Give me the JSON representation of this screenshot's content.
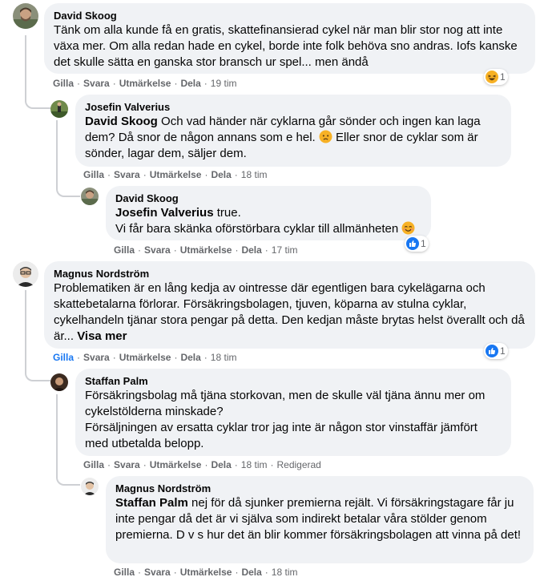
{
  "comments": [
    {
      "author": "David Skoog",
      "text": "Tänk om alla kunde få en gratis, skattefinansierad cykel när man blir stor nog att inte växa mer. Om alla redan hade en cykel, borde inte folk behöva sno andras. Iofs kanske det skulle sätta en ganska stor bransch ur spel... men ändå",
      "actions": {
        "like": "Gilla",
        "reply": "Svara",
        "award": "Utmärkelse",
        "share": "Dela",
        "time": "19 tim"
      },
      "reaction": {
        "icon": "haha-icon",
        "count": "1"
      }
    },
    {
      "author": "Josefin Valverius",
      "mention": "David Skoog",
      "text": " Och vad händer när cyklarna går sönder och ingen kan laga dem? Då snor de någon annans som e hel. ",
      "text_after": " Eller snor de cyklar som är sönder, lagar dem, säljer dem.",
      "actions": {
        "like": "Gilla",
        "reply": "Svara",
        "award": "Utmärkelse",
        "share": "Dela",
        "time": "18 tim"
      }
    },
    {
      "author": "David Skoog",
      "mention": "Josefin Valverius",
      "text": " true.",
      "text_line2": "Vi får bara skänka oförstörbara cyklar till allmänheten ",
      "actions": {
        "like": "Gilla",
        "reply": "Svara",
        "award": "Utmärkelse",
        "share": "Dela",
        "time": "17 tim"
      },
      "reaction": {
        "icon": "like-icon",
        "count": "1"
      }
    },
    {
      "author": "Magnus Nordström",
      "text": "Problematiken är en lång kedja av ointresse där egentligen bara cykelägarna och skattebetalarna förlorar. Försäkringsbolagen, tjuven, köparna av stulna cyklar, cykelhandeln tjänar stora pengar på detta. Den kedjan måste brytas helst överallt och då är... ",
      "see_more": "Visa mer",
      "actions": {
        "like": "Gilla",
        "reply": "Svara",
        "award": "Utmärkelse",
        "share": "Dela",
        "time": "18 tim"
      },
      "reaction": {
        "icon": "like-icon",
        "count": "1"
      }
    },
    {
      "author": "Staffan Palm",
      "text": "Försäkringsbolag må tjäna storkovan, men de skulle väl tjäna ännu mer om cykelstölderna minskade?\nFörsäljningen av ersatta cyklar tror jag inte är någon stor vinstaffär jämfört med utbetalda belopp.",
      "actions": {
        "like": "Gilla",
        "reply": "Svara",
        "award": "Utmärkelse",
        "share": "Dela",
        "time": "18 tim",
        "edited": "Redigerad"
      }
    },
    {
      "author": "Magnus Nordström",
      "mention": "Staffan Palm",
      "text": " nej för då sjunker premierna rejält. Vi försäkringstagare får ju inte pengar då det är vi själva som indirekt betalar våra stölder genom premierna. D v s hur det än blir kommer försäkringsbolagen att vinna på det!",
      "actions": {
        "like": "Gilla",
        "reply": "Svara",
        "award": "Utmärkelse",
        "share": "Dela",
        "time": "18 tim"
      }
    }
  ],
  "colors": {
    "bubble": "#f0f2f5",
    "meta": "#65676b",
    "link": "#1877f2",
    "like_blue": "#1877f2"
  }
}
